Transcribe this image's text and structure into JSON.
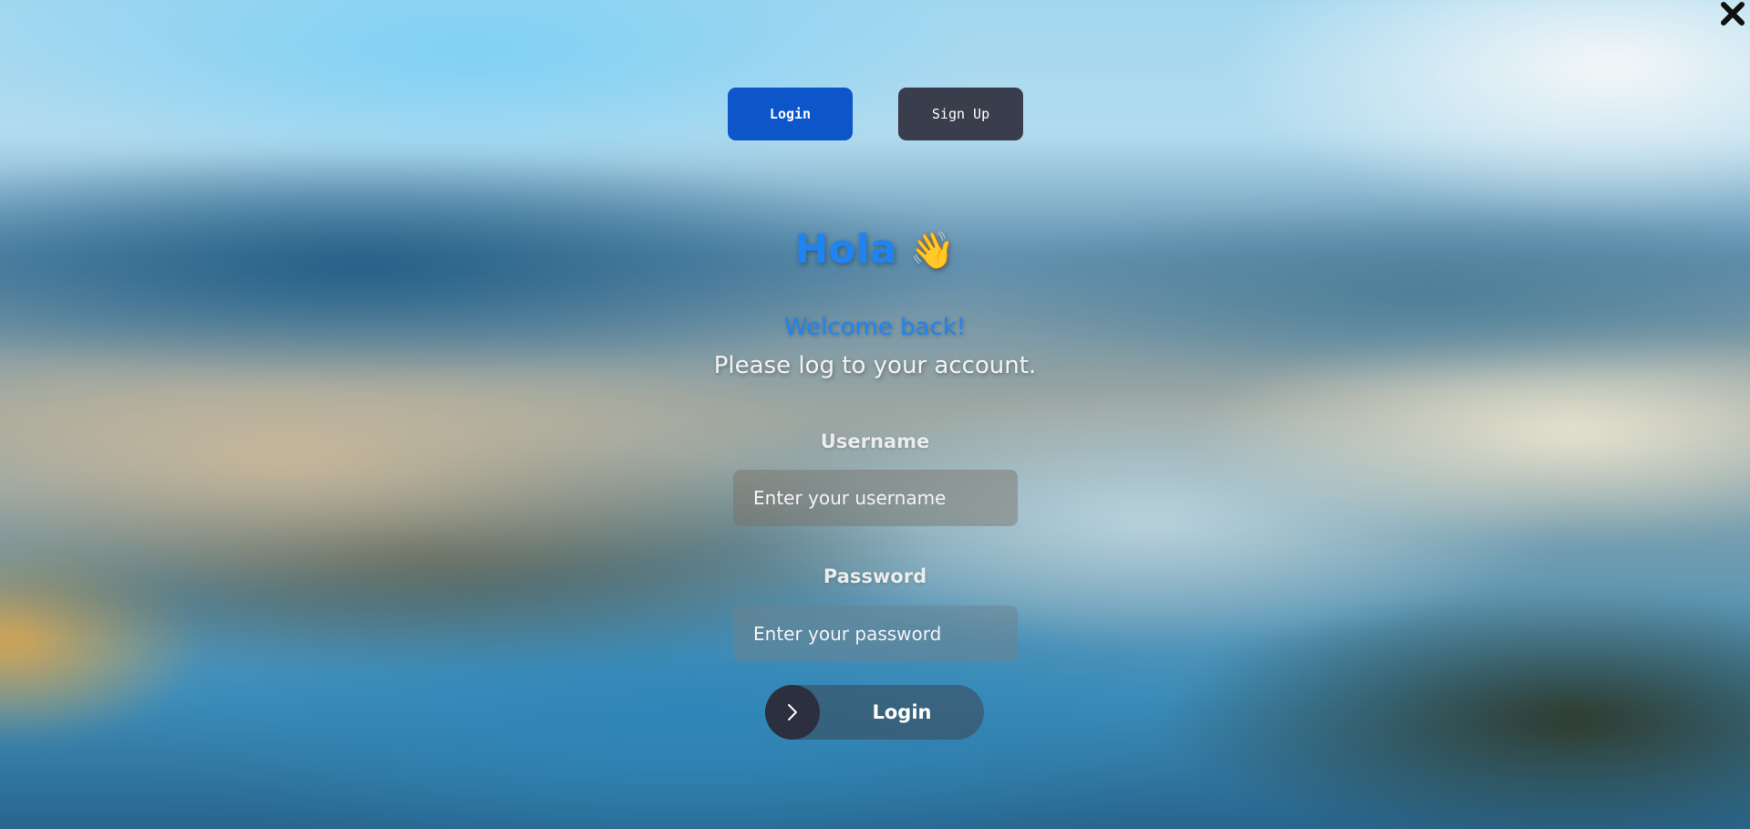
{
  "window": {
    "close_icon": "close-icon"
  },
  "tabs": {
    "login_label": "Login",
    "signup_label": "Sign Up"
  },
  "greeting": {
    "title": "Hola",
    "emoji": "👋",
    "welcome": "Welcome back!",
    "subtitle": "Please log to your account."
  },
  "form": {
    "username_label": "Username",
    "username_placeholder": "Enter your username",
    "username_value": "",
    "password_label": "Password",
    "password_placeholder": "Enter your password",
    "password_value": "",
    "submit_label": "Login",
    "submit_icon": "chevron-right-icon"
  },
  "colors": {
    "accent_blue": "#1f84f2",
    "login_tab": "#0d56c9",
    "signup_tab": "#3a3d4c",
    "submit_circle": "#2c2f3e"
  }
}
